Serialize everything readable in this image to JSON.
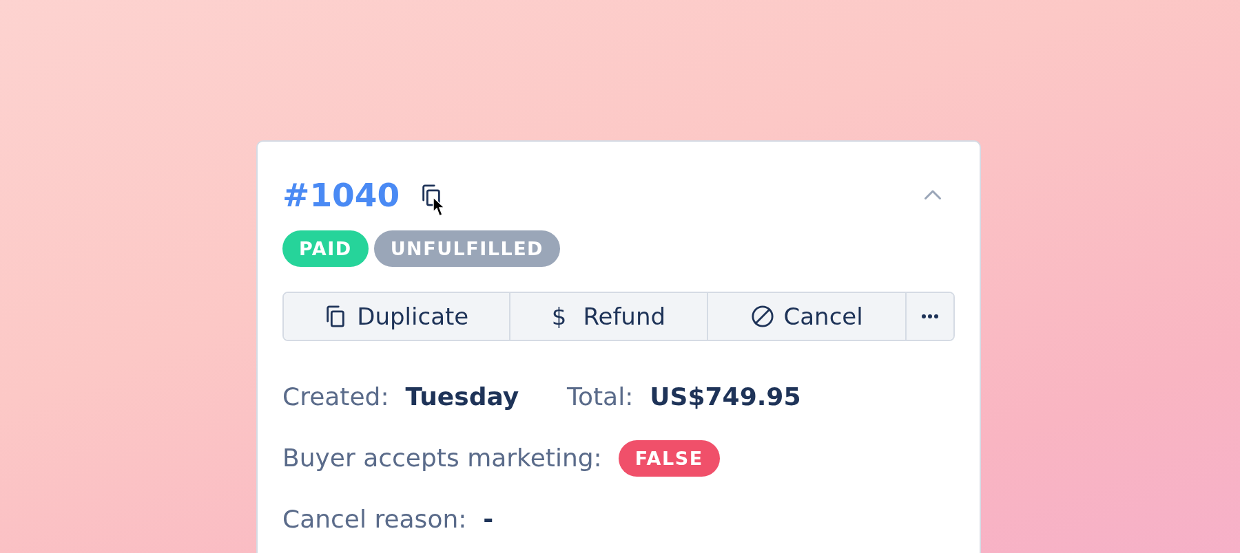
{
  "order": {
    "number": "#1040",
    "expanded": true,
    "statuses": [
      {
        "label": "PAID",
        "color": "#26d49a"
      },
      {
        "label": "UNFULFILLED",
        "color": "#9aa6b8"
      }
    ],
    "actions": [
      {
        "kind": "copy",
        "label": "Duplicate"
      },
      {
        "kind": "char",
        "icon": "$",
        "label": "Refund"
      },
      {
        "kind": "ban",
        "label": "Cancel"
      },
      {
        "kind": "more"
      }
    ],
    "details": [
      {
        "items": [
          {
            "kind": "text",
            "label": "Created:",
            "value": "Tuesday"
          },
          {
            "kind": "text",
            "label": "Total:",
            "value": "US$749.95"
          }
        ]
      },
      {
        "items": [
          {
            "kind": "badge",
            "label": "Buyer accepts marketing:",
            "value": "FALSE",
            "color": "#f0506a"
          }
        ]
      },
      {
        "items": [
          {
            "kind": "text",
            "label": "Cancel reason:",
            "value": "-"
          }
        ]
      }
    ]
  }
}
